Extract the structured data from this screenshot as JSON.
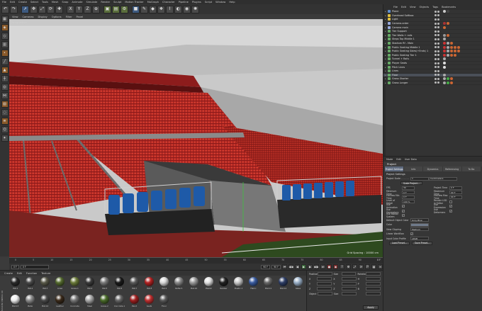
{
  "menubar": [
    "File",
    "Edit",
    "Create",
    "Select",
    "Tools",
    "Mesh",
    "Snap",
    "Animate",
    "Simulate",
    "Render",
    "Sculpt",
    "Motion Tracker",
    "MoGraph",
    "Character",
    "Pipeline",
    "Plugins",
    "Script",
    "Window",
    "Help"
  ],
  "toolbar": {
    "buttons": [
      {
        "name": "undo-button",
        "glyph": "↶",
        "style": ""
      },
      {
        "name": "redo-button",
        "glyph": "↷",
        "style": ""
      },
      {
        "name": "live-selection-button",
        "glyph": "➚",
        "style": "blue"
      },
      {
        "name": "move-button",
        "glyph": "✥",
        "style": ""
      },
      {
        "name": "scale-button",
        "glyph": "⤢",
        "style": ""
      },
      {
        "name": "rotate-button",
        "glyph": "⟳",
        "style": ""
      },
      {
        "name": "recent-tool-button",
        "glyph": "✚",
        "style": ""
      },
      {
        "name": "x-axis-button",
        "glyph": "X",
        "style": ""
      },
      {
        "name": "y-axis-button",
        "glyph": "Y",
        "style": ""
      },
      {
        "name": "z-axis-button",
        "glyph": "Z",
        "style": ""
      },
      {
        "name": "coord-system-button",
        "glyph": "⊕",
        "style": ""
      },
      {
        "name": "render-view-button",
        "glyph": "▣",
        "style": "accent"
      },
      {
        "name": "render-picture-viewer-button",
        "glyph": "▤",
        "style": "accent"
      },
      {
        "name": "edit-render-settings-button",
        "glyph": "⚙",
        "style": "accent"
      },
      {
        "name": "cube-button",
        "glyph": "■",
        "style": "blue"
      },
      {
        "name": "pen-button",
        "glyph": "✎",
        "style": ""
      },
      {
        "name": "subdivision-button",
        "glyph": "◆",
        "style": ""
      },
      {
        "name": "array-button",
        "glyph": "❖",
        "style": ""
      },
      {
        "name": "deformer-button",
        "glyph": "⌇",
        "style": ""
      },
      {
        "name": "environment-button",
        "glyph": "◐",
        "style": ""
      },
      {
        "name": "camera-button",
        "glyph": "◉",
        "style": ""
      },
      {
        "name": "light-button",
        "glyph": "✺",
        "style": ""
      }
    ]
  },
  "lefttools": [
    {
      "name": "make-editable-icon",
      "glyph": "▦",
      "style": ""
    },
    {
      "name": "model-mode-icon",
      "glyph": "◈",
      "style": "orange"
    },
    {
      "name": "texture-mode-icon",
      "glyph": "◇",
      "style": ""
    },
    {
      "name": "workplane-icon",
      "glyph": "▥",
      "style": ""
    },
    {
      "name": "points-mode-icon",
      "glyph": "•",
      "style": "orange"
    },
    {
      "name": "edges-mode-icon",
      "glyph": "╱",
      "style": ""
    },
    {
      "name": "polygons-mode-icon",
      "glyph": "▲",
      "style": "orange"
    },
    {
      "name": "axis-mode-icon",
      "glyph": "┼",
      "style": ""
    },
    {
      "name": "tweak-mode-icon",
      "glyph": "◎",
      "style": ""
    },
    {
      "name": "snap-icon",
      "glyph": "⋈",
      "style": ""
    },
    {
      "name": "lock-workplane-icon",
      "glyph": "▧",
      "style": "orange"
    },
    {
      "name": "solo-icon",
      "glyph": "◌",
      "style": ""
    },
    {
      "name": "layer-icon",
      "glyph": "≣",
      "style": "orange"
    },
    {
      "name": "xpresso-icon",
      "glyph": "⌬",
      "style": ""
    },
    {
      "name": "sculpt-icon",
      "glyph": "✦",
      "style": ""
    }
  ],
  "viewport": {
    "menu": [
      "View",
      "Cameras",
      "Display",
      "Options",
      "Filter",
      "Panel"
    ],
    "label": "Perspective",
    "grid_spacing": "Grid Spacing : 10000 cm"
  },
  "timeline": {
    "ticks": [
      "0",
      "5",
      "10",
      "15",
      "20",
      "25",
      "30",
      "35",
      "40",
      "45",
      "50",
      "55",
      "60",
      "65",
      "70",
      "75",
      "80",
      "85",
      "90"
    ],
    "end_label": "0 F"
  },
  "transport": {
    "start": "0 F",
    "current": "0 F",
    "end": "90 F",
    "end2": "90 F"
  },
  "materials": {
    "menu": [
      "Create",
      "Edit",
      "Function",
      "Texture"
    ],
    "side_label": "MAXON CINEMA 4D",
    "items": [
      {
        "label": "Mat.1",
        "color": "#2b2b2b"
      },
      {
        "label": "Mat.2",
        "color": "#4a4a4a"
      },
      {
        "label": "Mat.3",
        "color": "#5a5a4a"
      },
      {
        "label": "Grass",
        "color": "#556b2f"
      },
      {
        "label": "Grass.1",
        "color": "#6b7b3a"
      },
      {
        "label": "Mat.4",
        "color": "#3a3a3a"
      },
      {
        "label": "Mat.5",
        "color": "#7a7a7a"
      },
      {
        "label": "Mat.6",
        "color": "#1a1a1a"
      },
      {
        "label": "Mat.7",
        "color": "#5a5a5a"
      },
      {
        "label": "Mat.8",
        "color": "#b22222"
      },
      {
        "label": "Mat.9",
        "color": "#d8d8d8"
      },
      {
        "label": "Reflect.",
        "color": "#8a8a8a"
      },
      {
        "label": "Mat.10",
        "color": "#9a9a9a"
      },
      {
        "label": "Plastic",
        "color": "#e0e0e0"
      },
      {
        "label": "Rubber",
        "color": "#222"
      },
      {
        "label": "Plastic.1",
        "color": "#c8c8c8"
      },
      {
        "label": "Fabric",
        "color": "#3a5ca0"
      },
      {
        "label": "Mat.11",
        "color": "#6a6a6a"
      },
      {
        "label": "Mat.12",
        "color": "#2e3e66"
      },
      {
        "label": "Glass",
        "color": "#9ab0c8"
      },
      {
        "label": "Mat.13",
        "color": "#eeeeee"
      },
      {
        "label": "Metal",
        "color": "#8c8c8c"
      },
      {
        "label": "Mat.14",
        "color": "#4a4a4a"
      },
      {
        "label": "Leather",
        "color": "#3a2a1a"
      },
      {
        "label": "Concrete",
        "color": "#777"
      },
      {
        "label": "Steel",
        "color": "#aaaaaa"
      },
      {
        "label": "Grass.2",
        "color": "#4a6b2a"
      },
      {
        "label": "Concrete.1",
        "color": "#666"
      },
      {
        "label": "Paint",
        "color": "#a02020"
      },
      {
        "label": "Seats",
        "color": "#c03030"
      },
      {
        "label": "Floor",
        "color": "#5a5a5a"
      }
    ]
  },
  "coords": {
    "rows": [
      {
        "a": "Position",
        "b": "Size",
        "c": "Rotation"
      },
      {
        "a": "X",
        "b": "X",
        "c": "H"
      },
      {
        "a": "Y",
        "b": "Y",
        "c": "P"
      },
      {
        "a": "Z",
        "b": "Z",
        "c": "B"
      },
      {
        "a": "Object",
        "b": "Size",
        "c": ""
      }
    ],
    "apply": "Apply"
  },
  "objmgr": {
    "menu": [
      "File",
      "Edit",
      "View",
      "Objects",
      "Tags",
      "Bookmarks"
    ],
    "rows": [
      {
        "name": "Plane",
        "icon": "#5f8fd0",
        "sel": false,
        "tags": [
          "#ccc",
          "#444"
        ]
      },
      {
        "name": "Overhead Softbox",
        "icon": "#e0c040",
        "sel": false,
        "tags": []
      },
      {
        "name": "Light",
        "icon": "#e0c040",
        "sel": false,
        "tags": []
      },
      {
        "name": "Camera.order",
        "icon": "#9ad",
        "sel": false,
        "tags": [
          "#a33",
          "#c63"
        ]
      },
      {
        "name": "Camera main",
        "icon": "#9ad",
        "sel": false,
        "tags": [
          "#c63"
        ]
      },
      {
        "name": "Tier Support",
        "icon": "#6a6",
        "sel": false,
        "tags": []
      },
      {
        "name": "Tier Walls + rails",
        "icon": "#6a6",
        "sel": false,
        "tags": [
          "#999",
          "#c63"
        ]
      },
      {
        "name": "Steps Top Middle 1",
        "icon": "#6a6",
        "sel": false,
        "tags": [
          "#aaa"
        ]
      },
      {
        "name": "Stadium Rf - Main",
        "icon": "#6a6",
        "sel": false,
        "tags": [
          "#c33",
          "#aaa",
          "#c63"
        ]
      },
      {
        "name": "Public Seating Middle 1",
        "icon": "#6a6",
        "sel": false,
        "tags": [
          "#c33",
          "#aaa",
          "#c63",
          "#c63",
          "#c63"
        ]
      },
      {
        "name": "Public Seating Sides(+Ends) 1",
        "icon": "#6a6",
        "sel": false,
        "tags": [
          "#c33",
          "#aaa",
          "#c63",
          "#c63",
          "#c63"
        ]
      },
      {
        "name": "Public Seating Tier 1",
        "icon": "#6a6",
        "sel": false,
        "tags": [
          "#c33",
          "#aaa",
          "#c63",
          "#c63"
        ]
      },
      {
        "name": "Tunnel + Rails",
        "icon": "#6a6",
        "sel": false,
        "tags": [
          "#aaa"
        ]
      },
      {
        "name": "Player Seats",
        "icon": "#6a6",
        "sel": false,
        "tags": [
          "#ddd"
        ]
      },
      {
        "name": "Pitch Lines",
        "icon": "#6a6",
        "sel": false,
        "tags": [
          "#ddd"
        ]
      },
      {
        "name": "Lines",
        "icon": "#6a6",
        "sel": false,
        "tags": []
      },
      {
        "name": "Floor",
        "icon": "#6a6",
        "sel": true,
        "tags": [
          "#aaa"
        ]
      },
      {
        "name": "Grass Shorter",
        "icon": "#6a6",
        "sel": false,
        "tags": [
          "#aaa",
          "#4a4",
          "#c63"
        ]
      },
      {
        "name": "Grass Longer",
        "icon": "#6a6",
        "sel": false,
        "tags": [
          "#aaa",
          "#4a4",
          "#c63"
        ]
      }
    ]
  },
  "attrmgr": {
    "menu": [
      "Mode",
      "Edit",
      "User Data"
    ],
    "title": "Project",
    "tabs": [
      "Project Settings",
      "Info",
      "Dynamics",
      "Referencing",
      "To Do"
    ],
    "section": "Project Settings",
    "project_scale_label": "Project Scale . . . . . .",
    "project_scale_value": "1",
    "project_scale_unit": "Centimeters",
    "scale_button": "Scale Project...",
    "left": [
      {
        "label": "FPS",
        "value": "30"
      },
      {
        "label": "Minimum Time",
        "value": "0 F"
      },
      {
        "label": "Preview Min Time",
        "value": "0 F"
      },
      {
        "label": "Level of Detail",
        "value": "100 %"
      }
    ],
    "right": [
      {
        "label": "Project Time",
        "value": "0 F"
      },
      {
        "label": "Maximum Time",
        "value": "90 F"
      },
      {
        "label": "Preview Max Time",
        "value": "90 F"
      },
      {
        "label": "Render LOD in Editor",
        "value": ""
      }
    ],
    "checks_left": [
      "Use Animation",
      "Use Generators",
      "Use Motion System"
    ],
    "checks_right": [
      "Use Expression",
      "Use Deformers"
    ],
    "default_color_label": "Default Object Color",
    "default_color_value": "Gray-Blue",
    "color_label": "Color",
    "clipping_label": "View Clipping",
    "clipping_value": "Medium",
    "linear_label": "Linear Workflow",
    "input_profile_label": "Input Color Profile",
    "input_profile_value": "sRGB",
    "load_preset": "Load Preset...",
    "save_preset": "Save Preset..."
  }
}
